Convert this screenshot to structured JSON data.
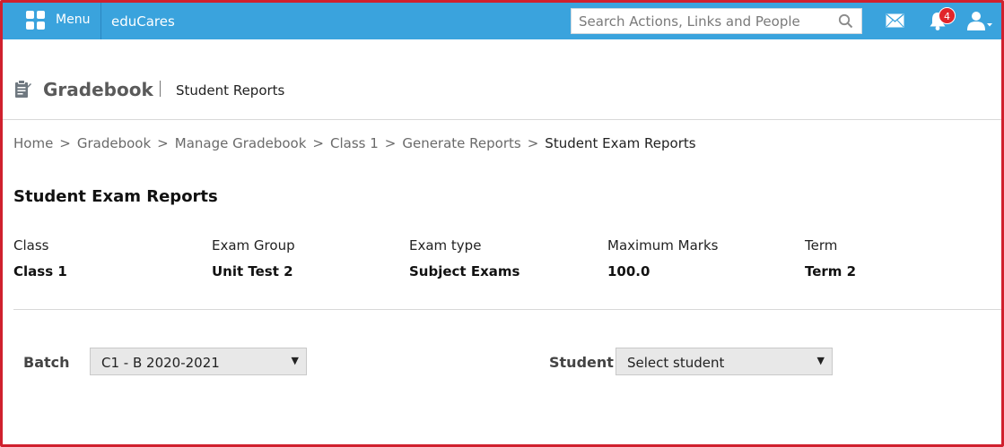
{
  "topbar": {
    "menu_label": "Menu",
    "brand": "eduCares",
    "search_placeholder": "Search Actions, Links and People",
    "notification_count": "4",
    "color": "#3aa3dd"
  },
  "header": {
    "title": "Gradebook",
    "subtitle": "Student Reports"
  },
  "breadcrumb": [
    "Home",
    "Gradebook",
    "Manage Gradebook",
    "Class 1",
    "Generate Reports",
    "Student Exam Reports"
  ],
  "section": {
    "title": "Student Exam Reports",
    "info": [
      {
        "label": "Class",
        "value": "Class 1"
      },
      {
        "label": "Exam Group",
        "value": "Unit Test 2"
      },
      {
        "label": "Exam type",
        "value": "Subject Exams"
      },
      {
        "label": "Maximum Marks",
        "value": "100.0"
      },
      {
        "label": "Term",
        "value": "Term 2"
      }
    ]
  },
  "filters": {
    "batch_label": "Batch",
    "batch_value": "C1 - B 2020-2021",
    "student_label": "Student",
    "student_value": "Select student"
  }
}
